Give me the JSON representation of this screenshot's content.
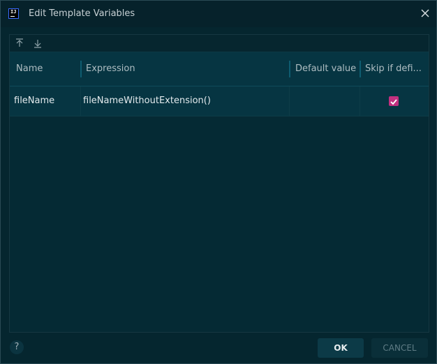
{
  "window": {
    "title": "Edit Template Variables"
  },
  "toolbar": {
    "move_up_icon": "arrow-up-icon",
    "move_down_icon": "arrow-down-icon"
  },
  "table": {
    "columns": [
      "Name",
      "Expression",
      "Default value",
      "Skip if defi..."
    ],
    "rows": [
      {
        "name": "fileName",
        "expression": "fileNameWithoutExtension()",
        "default_value": "",
        "skip_if_defined": true
      }
    ]
  },
  "footer": {
    "help_label": "?",
    "ok_label": "OK",
    "cancel_label": "CANCEL"
  },
  "colors": {
    "accent": "#c1307f",
    "background": "#05262f"
  }
}
